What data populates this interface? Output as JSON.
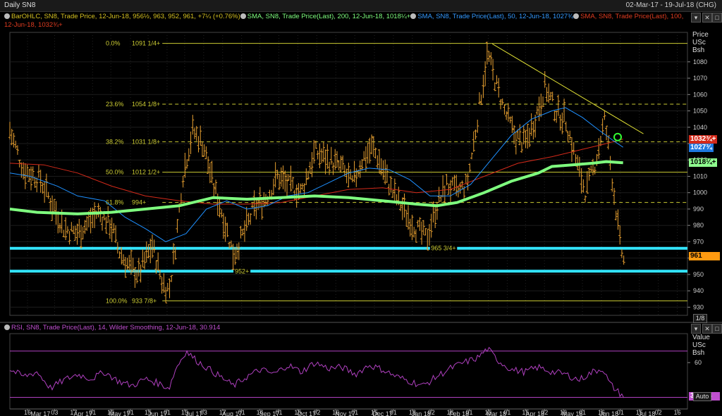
{
  "window": {
    "title": "Daily SN8",
    "date_range": "02-Mar-17 - 19-Jul-18 (CHG)"
  },
  "legend": {
    "price": "BarOHLC, SN8, Trade Price, 12-Jun-18, 956½, 963, 952, 961, +7¼ (+0.76%)",
    "sma200": "SMA, SN8, Trade Price(Last), 200, 12-Jun-18, 1018¼+",
    "sma50": "SMA, SN8, Trade Price(Last), 50, 12-Jun-18, 1027¾",
    "sma100_a": "SMA, SN8, Trade Price(Last), 100,",
    "sma100_b": "12-Jun-18, 1032¾+",
    "rsi": "RSI, SN8, Trade Price(Last), 14, Wilder Smoothing, 12-Jun-18, 30.914"
  },
  "colors": {
    "bars": "#e8a030",
    "sma200": "#7fff7f",
    "sma50": "#1e90ff",
    "sma100": "#d42a1a",
    "fib": "#cccc33",
    "support": "#33e5ff",
    "rsi": "#b040c0",
    "trend": "#dddd33"
  },
  "axis_header": {
    "price_l1": "Price",
    "price_l2": "USc",
    "price_l3": "Bsh",
    "rsi_l1": "Value",
    "rsi_l2": "USc",
    "rsi_l3": "Bsh"
  },
  "axis_tags": {
    "sma100": "1032¾+",
    "sma50": "1027¾",
    "sma200": "1018¼+",
    "last": "961",
    "rsi": "30.914",
    "scale_btn": "1/8",
    "auto_btn": "Auto"
  },
  "fib_levels": [
    {
      "pct": "0.0%",
      "label": "1091 1/4+",
      "value": 1091.25,
      "style": "solid"
    },
    {
      "pct": "23.6%",
      "label": "1054 1/8+",
      "value": 1054.125,
      "style": "dashed"
    },
    {
      "pct": "38.2%",
      "label": "1031 1/8+",
      "value": 1031.125,
      "style": "dashed"
    },
    {
      "pct": "50.0%",
      "label": "1012 1/2+",
      "value": 1012.5,
      "style": "solid"
    },
    {
      "pct": "61.8%",
      "label": "994+",
      "value": 994,
      "style": "dashed"
    },
    {
      "pct": "100.0%",
      "label": "933 7/8+",
      "value": 933.875,
      "style": "solid"
    }
  ],
  "support_levels": [
    {
      "label": "965 3/4+",
      "value": 966
    },
    {
      "label": "952+",
      "value": 952
    }
  ],
  "chart_data": {
    "type": "line",
    "title": "Daily SN8",
    "y_ticks": [
      930,
      940,
      950,
      960,
      970,
      980,
      990,
      1000,
      1010,
      1020,
      1030,
      1040,
      1050,
      1060,
      1070,
      1080
    ],
    "ylim": [
      925,
      1098
    ],
    "xlim": [
      0,
      1.0
    ],
    "x_ticks": [
      {
        "t": 0.026,
        "d": "16"
      },
      {
        "t": 0.066,
        "d": "03"
      },
      {
        "t": 0.094,
        "d": "17"
      },
      {
        "t": 0.122,
        "d": "01"
      },
      {
        "t": 0.149,
        "d": "15"
      },
      {
        "t": 0.178,
        "d": "01"
      },
      {
        "t": 0.204,
        "d": "15"
      },
      {
        "t": 0.232,
        "d": "01"
      },
      {
        "t": 0.258,
        "d": "15"
      },
      {
        "t": 0.286,
        "d": "03"
      },
      {
        "t": 0.314,
        "d": "17"
      },
      {
        "t": 0.342,
        "d": "01"
      },
      {
        "t": 0.369,
        "d": "16"
      },
      {
        "t": 0.397,
        "d": "01"
      },
      {
        "t": 0.425,
        "d": "15"
      },
      {
        "t": 0.453,
        "d": "02"
      },
      {
        "t": 0.481,
        "d": "16"
      },
      {
        "t": 0.509,
        "d": "01"
      },
      {
        "t": 0.538,
        "d": "15"
      },
      {
        "t": 0.566,
        "d": "01"
      },
      {
        "t": 0.594,
        "d": "18"
      },
      {
        "t": 0.622,
        "d": "02"
      },
      {
        "t": 0.65,
        "d": "16"
      },
      {
        "t": 0.678,
        "d": "01"
      },
      {
        "t": 0.706,
        "d": "15"
      },
      {
        "t": 0.734,
        "d": "01"
      },
      {
        "t": 0.761,
        "d": "15"
      },
      {
        "t": 0.789,
        "d": "02"
      },
      {
        "t": 0.817,
        "d": "16"
      },
      {
        "t": 0.845,
        "d": "01"
      },
      {
        "t": 0.873,
        "d": "16"
      },
      {
        "t": 0.901,
        "d": "01"
      },
      {
        "t": 0.929,
        "d": "15"
      },
      {
        "t": 0.957,
        "d": "02"
      },
      {
        "t": 0.985,
        "d": "16"
      }
    ],
    "month_labels": [
      {
        "t": 0.045,
        "m": "Mar 17"
      },
      {
        "t": 0.108,
        "m": "Apr 17"
      },
      {
        "t": 0.162,
        "m": "May 17"
      },
      {
        "t": 0.218,
        "m": "Jun 17"
      },
      {
        "t": 0.272,
        "m": "Jul 17"
      },
      {
        "t": 0.328,
        "m": "Aug 17"
      },
      {
        "t": 0.383,
        "m": "Sep 17"
      },
      {
        "t": 0.438,
        "m": "Oct 17"
      },
      {
        "t": 0.495,
        "m": "Nov 17"
      },
      {
        "t": 0.55,
        "m": "Dec 17"
      },
      {
        "t": 0.607,
        "m": "Jan 18"
      },
      {
        "t": 0.663,
        "m": "Feb 18"
      },
      {
        "t": 0.718,
        "m": "Mar 18"
      },
      {
        "t": 0.775,
        "m": "Apr 18"
      },
      {
        "t": 0.83,
        "m": "May 18"
      },
      {
        "t": 0.884,
        "m": "Jun 18"
      },
      {
        "t": 0.94,
        "m": "Jul 18"
      }
    ],
    "price_path": [
      [
        0.0,
        1038
      ],
      [
        0.02,
        1014
      ],
      [
        0.045,
        1008
      ],
      [
        0.06,
        995
      ],
      [
        0.08,
        978
      ],
      [
        0.1,
        975
      ],
      [
        0.13,
        988
      ],
      [
        0.15,
        980
      ],
      [
        0.16,
        965
      ],
      [
        0.175,
        955
      ],
      [
        0.19,
        950
      ],
      [
        0.21,
        968
      ],
      [
        0.225,
        945
      ],
      [
        0.235,
        940
      ],
      [
        0.245,
        970
      ],
      [
        0.255,
        1010
      ],
      [
        0.27,
        1038
      ],
      [
        0.285,
        1030
      ],
      [
        0.3,
        1005
      ],
      [
        0.315,
        985
      ],
      [
        0.33,
        962
      ],
      [
        0.345,
        975
      ],
      [
        0.36,
        990
      ],
      [
        0.38,
        998
      ],
      [
        0.395,
        1010
      ],
      [
        0.41,
        1005
      ],
      [
        0.43,
        1000
      ],
      [
        0.45,
        1025
      ],
      [
        0.47,
        1020
      ],
      [
        0.49,
        1015
      ],
      [
        0.505,
        1005
      ],
      [
        0.52,
        1020
      ],
      [
        0.535,
        1028
      ],
      [
        0.55,
        1015
      ],
      [
        0.565,
        1000
      ],
      [
        0.58,
        990
      ],
      [
        0.6,
        978
      ],
      [
        0.615,
        972
      ],
      [
        0.63,
        992
      ],
      [
        0.645,
        1005
      ],
      [
        0.66,
        1000
      ],
      [
        0.675,
        1005
      ],
      [
        0.69,
        1045
      ],
      [
        0.705,
        1085
      ],
      [
        0.715,
        1070
      ],
      [
        0.73,
        1050
      ],
      [
        0.745,
        1035
      ],
      [
        0.76,
        1030
      ],
      [
        0.775,
        1045
      ],
      [
        0.79,
        1065
      ],
      [
        0.805,
        1050
      ],
      [
        0.82,
        1045
      ],
      [
        0.835,
        1020
      ],
      [
        0.85,
        1000
      ],
      [
        0.865,
        1020
      ],
      [
        0.878,
        1045
      ],
      [
        0.888,
        1012
      ],
      [
        0.896,
        985
      ],
      [
        0.9,
        970
      ],
      [
        0.906,
        958
      ]
    ],
    "sma200": [
      [
        0.0,
        990
      ],
      [
        0.04,
        988
      ],
      [
        0.1,
        987
      ],
      [
        0.15,
        988
      ],
      [
        0.2,
        990
      ],
      [
        0.25,
        992
      ],
      [
        0.3,
        997
      ],
      [
        0.35,
        996
      ],
      [
        0.4,
        997
      ],
      [
        0.45,
        998
      ],
      [
        0.5,
        997
      ],
      [
        0.55,
        995
      ],
      [
        0.6,
        993
      ],
      [
        0.63,
        992
      ],
      [
        0.66,
        994
      ],
      [
        0.7,
        1000
      ],
      [
        0.74,
        1007
      ],
      [
        0.78,
        1012
      ],
      [
        0.8,
        1016
      ],
      [
        0.83,
        1017
      ],
      [
        0.86,
        1018
      ],
      [
        0.88,
        1019
      ],
      [
        0.905,
        1018.25
      ]
    ],
    "sma50": [
      [
        0.0,
        1012
      ],
      [
        0.03,
        1010
      ],
      [
        0.07,
        1004
      ],
      [
        0.1,
        998
      ],
      [
        0.14,
        995
      ],
      [
        0.17,
        985
      ],
      [
        0.2,
        978
      ],
      [
        0.23,
        970
      ],
      [
        0.26,
        975
      ],
      [
        0.29,
        990
      ],
      [
        0.32,
        995
      ],
      [
        0.35,
        990
      ],
      [
        0.38,
        992
      ],
      [
        0.41,
        998
      ],
      [
        0.44,
        1000
      ],
      [
        0.47,
        1006
      ],
      [
        0.5,
        1012
      ],
      [
        0.53,
        1015
      ],
      [
        0.56,
        1014
      ],
      [
        0.59,
        1008
      ],
      [
        0.62,
        998
      ],
      [
        0.65,
        998
      ],
      [
        0.68,
        1005
      ],
      [
        0.71,
        1020
      ],
      [
        0.74,
        1035
      ],
      [
        0.77,
        1045
      ],
      [
        0.8,
        1050
      ],
      [
        0.82,
        1052
      ],
      [
        0.845,
        1046
      ],
      [
        0.87,
        1038
      ],
      [
        0.89,
        1032
      ],
      [
        0.905,
        1027.75
      ]
    ],
    "sma100": [
      [
        0.0,
        1018
      ],
      [
        0.05,
        1017
      ],
      [
        0.1,
        1012
      ],
      [
        0.15,
        1004
      ],
      [
        0.2,
        998
      ],
      [
        0.25,
        995
      ],
      [
        0.3,
        993
      ],
      [
        0.35,
        993
      ],
      [
        0.4,
        994
      ],
      [
        0.45,
        998
      ],
      [
        0.5,
        1002
      ],
      [
        0.55,
        1003
      ],
      [
        0.6,
        1000
      ],
      [
        0.65,
        1002
      ],
      [
        0.7,
        1010
      ],
      [
        0.75,
        1018
      ],
      [
        0.8,
        1022
      ],
      [
        0.85,
        1027
      ],
      [
        0.88,
        1030
      ],
      [
        0.905,
        1032.75
      ]
    ],
    "trendline": [
      [
        0.712,
        1091
      ],
      [
        0.935,
        1036
      ]
    ],
    "circle_marker": {
      "t": 0.897,
      "v": 1034
    },
    "rsi": {
      "ylim": [
        20,
        85
      ],
      "ticks": [
        60
      ],
      "ref_levels": [
        70,
        30
      ],
      "path": [
        [
          0.0,
          54
        ],
        [
          0.02,
          48
        ],
        [
          0.04,
          52
        ],
        [
          0.06,
          38
        ],
        [
          0.08,
          45
        ],
        [
          0.1,
          50
        ],
        [
          0.12,
          46
        ],
        [
          0.14,
          52
        ],
        [
          0.16,
          44
        ],
        [
          0.18,
          40
        ],
        [
          0.2,
          46
        ],
        [
          0.22,
          42
        ],
        [
          0.235,
          38
        ],
        [
          0.245,
          55
        ],
        [
          0.26,
          70
        ],
        [
          0.275,
          62
        ],
        [
          0.29,
          56
        ],
        [
          0.31,
          48
        ],
        [
          0.33,
          40
        ],
        [
          0.35,
          48
        ],
        [
          0.37,
          54
        ],
        [
          0.39,
          50
        ],
        [
          0.41,
          58
        ],
        [
          0.43,
          52
        ],
        [
          0.45,
          60
        ],
        [
          0.47,
          55
        ],
        [
          0.49,
          56
        ],
        [
          0.51,
          50
        ],
        [
          0.53,
          58
        ],
        [
          0.55,
          54
        ],
        [
          0.57,
          48
        ],
        [
          0.59,
          44
        ],
        [
          0.61,
          40
        ],
        [
          0.63,
          48
        ],
        [
          0.65,
          55
        ],
        [
          0.67,
          60
        ],
        [
          0.69,
          64
        ],
        [
          0.705,
          72
        ],
        [
          0.72,
          62
        ],
        [
          0.74,
          54
        ],
        [
          0.76,
          52
        ],
        [
          0.78,
          56
        ],
        [
          0.8,
          52
        ],
        [
          0.82,
          50
        ],
        [
          0.84,
          45
        ],
        [
          0.86,
          52
        ],
        [
          0.875,
          55
        ],
        [
          0.885,
          42
        ],
        [
          0.895,
          36
        ],
        [
          0.906,
          30.914
        ]
      ]
    }
  }
}
